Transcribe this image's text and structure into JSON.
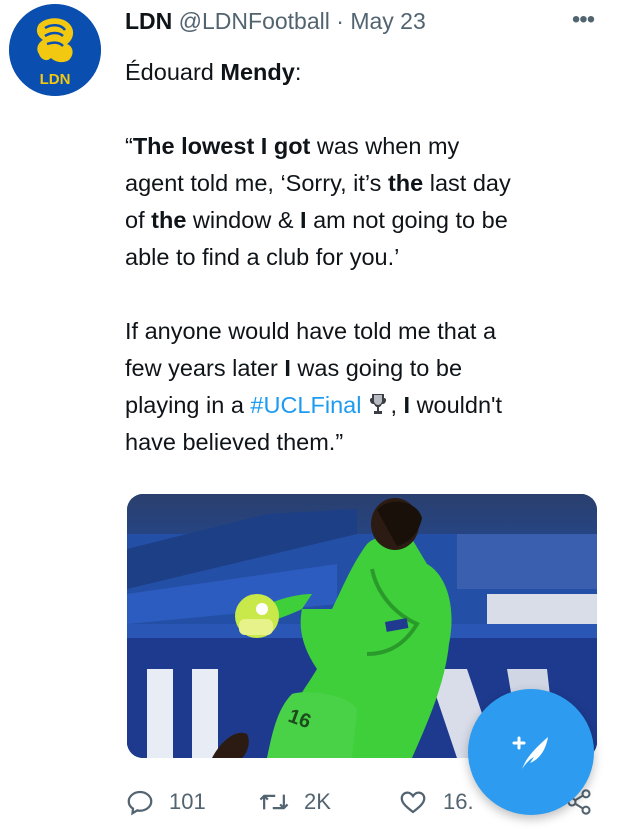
{
  "tweet": {
    "author_name": "LDN",
    "handle": "@LDNFootball",
    "separator": "·",
    "date": "May 23",
    "avatar_text": "LDN",
    "more_label": "•••",
    "line0": {
      "a": "Édouard ",
      "b": "Mendy",
      "c": ":"
    },
    "line1": {
      "a": "“",
      "b": "The lowest I got",
      "c": " was when my"
    },
    "line2": {
      "a": "agent told me, ‘Sorry, it’s ",
      "b": "the",
      "c": " last day"
    },
    "line3": {
      "a": "of ",
      "b": "the",
      "c": " window & ",
      "d": "I",
      "e": " am not going to be"
    },
    "line4": "able to find a club for you.’",
    "line5": "If anyone would have told me that a",
    "line6": {
      "a": "few years later ",
      "b": "I",
      "c": " was going to be"
    },
    "line7": {
      "a": "playing in a ",
      "hashtag": "#UCLFinal",
      "b": ", ",
      "c": "I",
      "d": " wouldn't"
    },
    "line8": "have believed them.”"
  },
  "media": {
    "jersey_number": "16",
    "alt_icon": "photo"
  },
  "actions": {
    "replies": "101",
    "retweets": "2K",
    "likes": "16.",
    "icons": [
      "reply-icon",
      "retweet-icon",
      "like-icon",
      "share-icon"
    ]
  },
  "fab": {
    "icon": "compose-tweet-icon",
    "color": "#2d9cf0"
  },
  "colors": {
    "link": "#1d9bf0",
    "muted": "#536471",
    "text": "#0f1419",
    "avatar_bg": "#0a4fb0",
    "avatar_gold": "#f2c811"
  }
}
